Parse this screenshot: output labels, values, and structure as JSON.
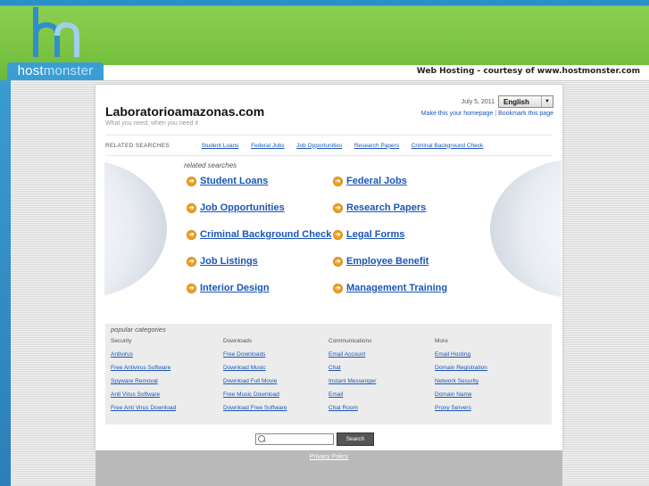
{
  "brand": {
    "tab_host": "host",
    "tab_monster": "monster",
    "courtesy": "Web Hosting - courtesy of www.hostmonster.com"
  },
  "site": {
    "title": "Laboratorioamazonas.com",
    "tagline": "What you need, when you need it",
    "date": "July 5, 2011",
    "language": "English",
    "make_homepage": "Make this your homepage",
    "bookmark": "Bookmark this page"
  },
  "related_bar": {
    "label": "RELATED SEARCHES",
    "links": [
      "Student Loans",
      "Federal Jobs",
      "Job Opportunities",
      "Research Papers",
      "Criminal Background Check"
    ]
  },
  "related_searches": {
    "heading": "related searches",
    "items": [
      "Student Loans",
      "Federal Jobs",
      "Job Opportunities",
      "Research Papers",
      "Criminal Background Check",
      "Legal Forms",
      "Job Listings",
      "Employee Benefit",
      "Interior Design",
      "Management Training"
    ]
  },
  "popular": {
    "title": "popular categories",
    "columns": [
      {
        "heading": "Security",
        "links": [
          "Antivirus",
          "Free Antivirus Software",
          "Spyware Removal",
          "Anti Virus Software",
          "Free Anti Virus Download"
        ]
      },
      {
        "heading": "Downloads",
        "links": [
          "Free Downloads",
          "Download Music",
          "Download Full Movie",
          "Free Music Download",
          "Download Free Software"
        ]
      },
      {
        "heading": "Communications",
        "links": [
          "Email Account",
          "Chat",
          "Instant Messenger",
          "Email",
          "Chat Room"
        ]
      },
      {
        "heading": "More",
        "links": [
          "Email Hosting",
          "Domain Registration",
          "Network Security",
          "Domain Name",
          "Proxy Servers"
        ]
      }
    ]
  },
  "search": {
    "placeholder": "",
    "button": "Search"
  },
  "footer": {
    "privacy": "Privacy Policy"
  },
  "colors": {
    "header_green": "#79c341",
    "header_blue": "#2f9ad2",
    "link_blue": "#1a56b8",
    "arrow_orange": "#f0a020"
  },
  "icons": [
    "hostmonster-logo",
    "chevron-down-icon",
    "arrow-right-icon",
    "search-icon"
  ]
}
